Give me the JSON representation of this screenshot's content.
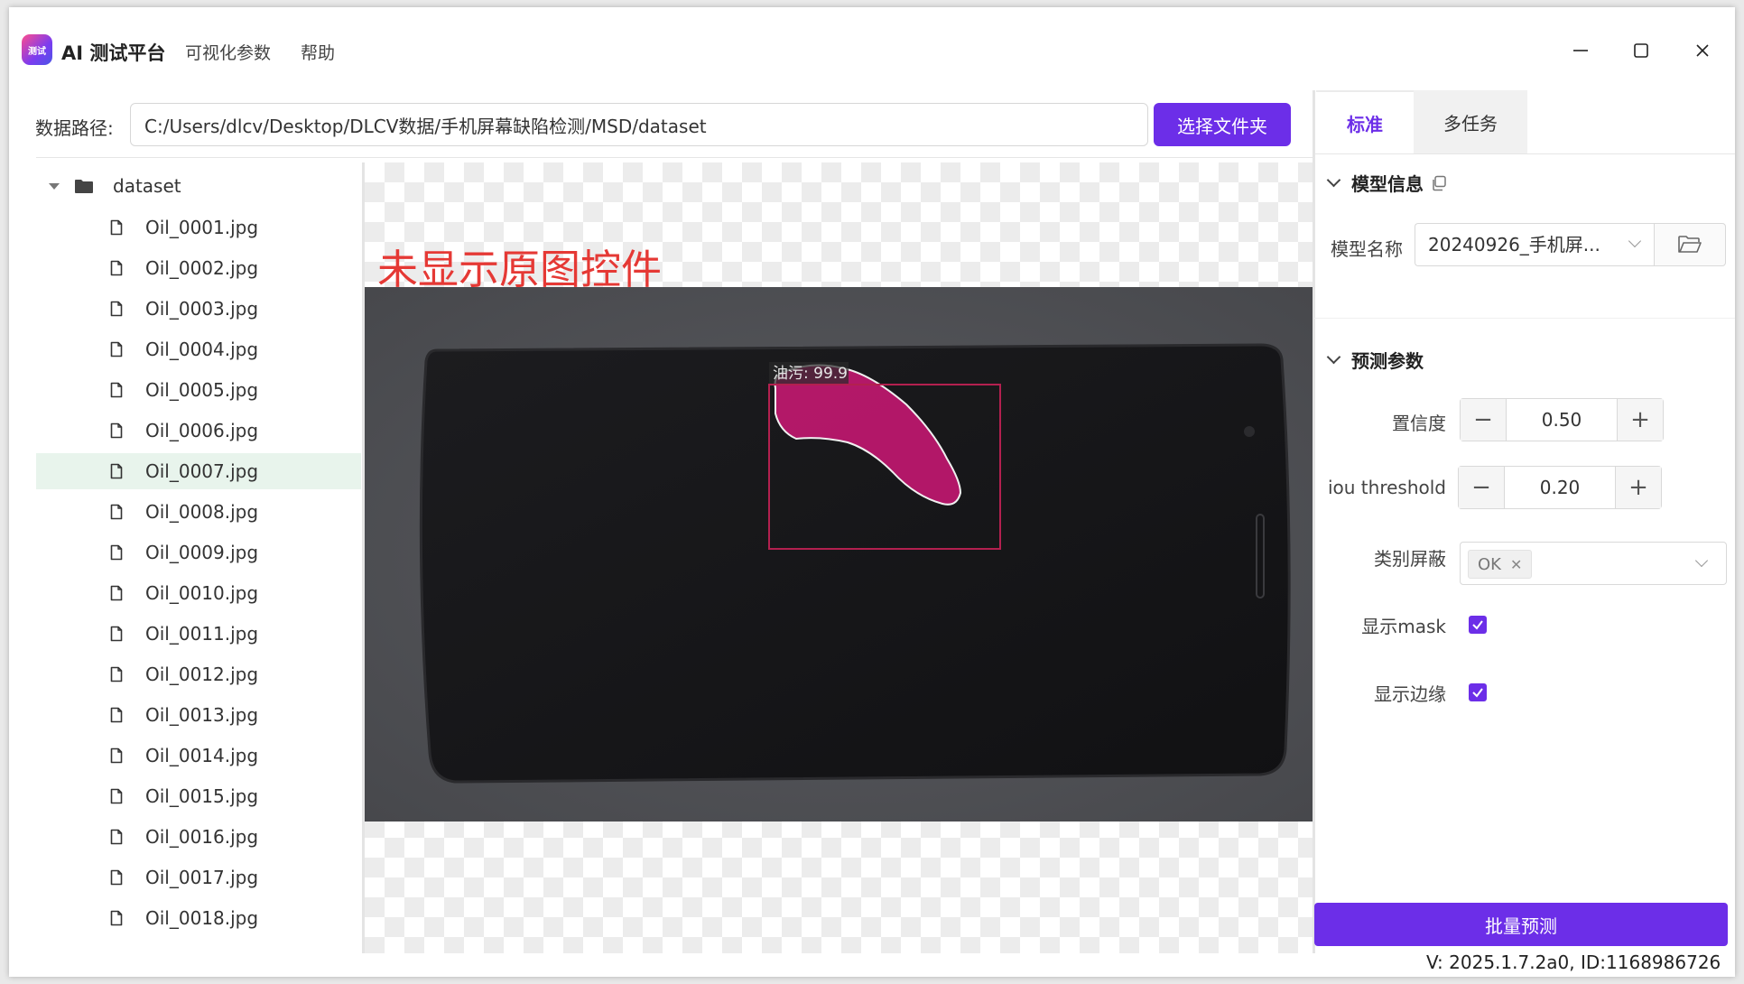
{
  "app": {
    "logo_text": "测试",
    "title": "AI 测试平台",
    "menu": [
      "可视化参数",
      "帮助"
    ]
  },
  "path_row": {
    "label": "数据路径:",
    "value": "C:/Users/dlcv/Desktop/DLCV数据/手机屏幕缺陷检测/MSD/dataset",
    "choose_button": "选择文件夹"
  },
  "tree": {
    "root": "dataset",
    "selected_index": 6,
    "files": [
      "Oil_0001.jpg",
      "Oil_0002.jpg",
      "Oil_0003.jpg",
      "Oil_0004.jpg",
      "Oil_0005.jpg",
      "Oil_0006.jpg",
      "Oil_0007.jpg",
      "Oil_0008.jpg",
      "Oil_0009.jpg",
      "Oil_0010.jpg",
      "Oil_0011.jpg",
      "Oil_0012.jpg",
      "Oil_0013.jpg",
      "Oil_0014.jpg",
      "Oil_0015.jpg",
      "Oil_0016.jpg",
      "Oil_0017.jpg",
      "Oil_0018.jpg"
    ]
  },
  "viewer": {
    "overlay_text": "未显示原图控件",
    "detection_label": "油污: 99.9"
  },
  "panel": {
    "tabs": [
      "标准",
      "多任务"
    ],
    "active_tab": "标准",
    "model_section": {
      "title": "模型信息",
      "name_label": "模型名称",
      "name_value": "20240926_手机屏..."
    },
    "predict_section": {
      "title": "预测参数",
      "confidence_label": "置信度",
      "confidence_value": "0.50",
      "iou_label": "iou threshold",
      "iou_value": "0.20",
      "class_mask_label": "类别屏蔽",
      "class_mask_tag": "OK",
      "show_mask_label": "显示mask",
      "show_mask_checked": true,
      "show_edge_label": "显示边缘",
      "show_edge_checked": true
    },
    "run_button": "批量预测",
    "version": "V: 2025.1.7.2a0, ID:1168986726"
  },
  "colors": {
    "accent": "#6c2ee8",
    "selected_row": "#e8f4ec",
    "overlay_text": "#e53935",
    "mask": "#c0186f",
    "bbox": "#b3204f"
  }
}
